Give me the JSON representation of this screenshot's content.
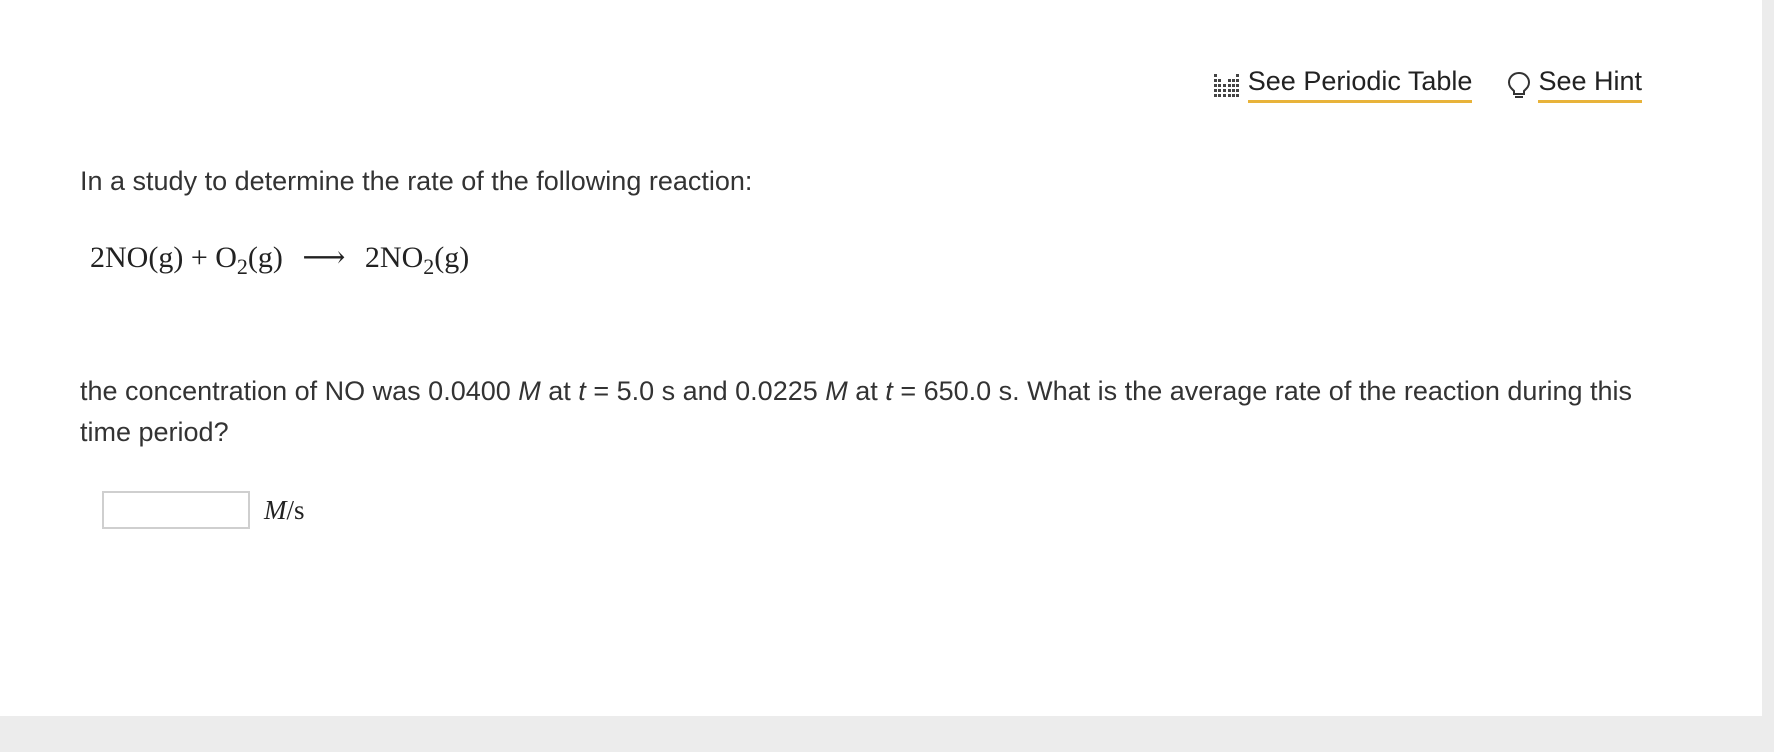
{
  "toolbar": {
    "periodic_table_label": "See Periodic Table",
    "hint_label": "See Hint",
    "periodic_table_icon": "periodic-table-icon",
    "hint_icon": "lightbulb-icon",
    "underline_color": "#e8b33a"
  },
  "question": {
    "intro": "In a study to determine the rate of the following reaction:",
    "equation": {
      "coef_no": "2NO",
      "state1": "(g)",
      "plus": "+",
      "o": "O",
      "o_sub": "2",
      "state2": "(g)",
      "arrow": "⟶",
      "product": "2NO",
      "product_sub": "2",
      "state3": "(g)"
    },
    "text_1": "the concentration of NO was 0.0400 ",
    "m1": "M",
    "text_2": " at ",
    "t1": "t",
    "text_3": " = 5.0 s and 0.0225 ",
    "m2": "M",
    "text_4": " at ",
    "t2": "t",
    "text_5": " = 650.0 s. What is the average rate of the reaction during this time period?"
  },
  "answer": {
    "value": "",
    "unit_m": "M",
    "unit_rest": "/s"
  }
}
